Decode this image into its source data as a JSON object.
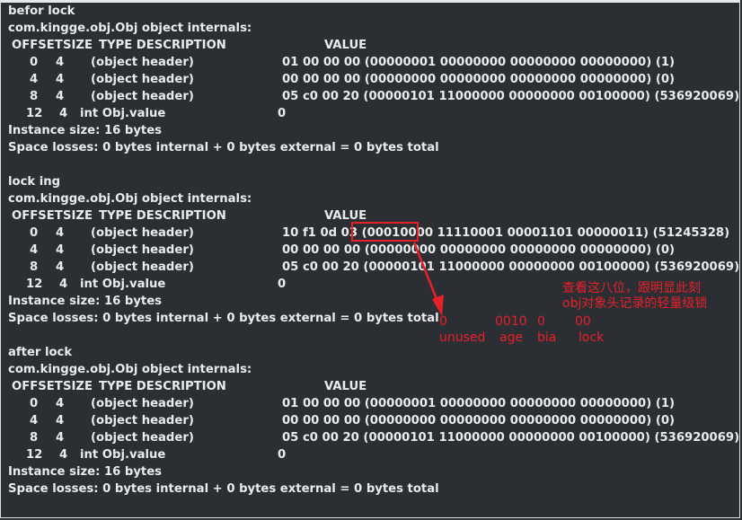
{
  "blocks": [
    {
      "title": "befor lock",
      "class_line": "com.kingge.obj.Obj object internals:",
      "header": {
        "offset": "OFFSET",
        "size": "SIZE",
        "type": "TYPE DESCRIPTION",
        "value": "VALUE"
      },
      "rows": [
        {
          "offset": "0",
          "size": "4",
          "type": "(object header)",
          "value": "01 00 00 00 (00000001 00000000 00000000 00000000) (1)"
        },
        {
          "offset": "4",
          "size": "4",
          "type": "(object header)",
          "value": "00 00 00 00 (00000000 00000000 00000000 00000000) (0)"
        },
        {
          "offset": "8",
          "size": "4",
          "type": "(object header)",
          "value": "05 c0 00 20 (00000101 11000000 00000000 00100000) (536920069)"
        },
        {
          "offset": "12",
          "size": "4",
          "type": "int Obj.value",
          "value": "0"
        }
      ],
      "instance": "Instance size: 16 bytes",
      "losses": "Space losses: 0 bytes internal + 0 bytes external = 0 bytes total"
    },
    {
      "title": "lock ing",
      "class_line": "com.kingge.obj.Obj object internals:",
      "header": {
        "offset": "OFFSET",
        "size": "SIZE",
        "type": "TYPE DESCRIPTION",
        "value": "VALUE"
      },
      "rows": [
        {
          "offset": "0",
          "size": "4",
          "type": "(object header)",
          "value": "10 f1 0d 03 (00010000 11110001 00001101 00000011) (51245328)"
        },
        {
          "offset": "4",
          "size": "4",
          "type": "(object header)",
          "value": "00 00 00 00 (00000000 00000000 00000000 00000000) (0)"
        },
        {
          "offset": "8",
          "size": "4",
          "type": "(object header)",
          "value": "05 c0 00 20 (00000101 11000000 00000000 00100000) (536920069)"
        },
        {
          "offset": "12",
          "size": "4",
          "type": "int Obj.value",
          "value": "0"
        }
      ],
      "instance": "Instance size: 16 bytes",
      "losses": "Space losses: 0 bytes internal + 0 bytes external = 0 bytes total"
    },
    {
      "title": "after lock",
      "class_line": "com.kingge.obj.Obj object internals:",
      "header": {
        "offset": "OFFSET",
        "size": "SIZE",
        "type": "TYPE DESCRIPTION",
        "value": "VALUE"
      },
      "rows": [
        {
          "offset": "0",
          "size": "4",
          "type": "(object header)",
          "value": "01 00 00 00 (00000001 00000000 00000000 00000000) (1)"
        },
        {
          "offset": "4",
          "size": "4",
          "type": "(object header)",
          "value": "00 00 00 00 (00000000 00000000 00000000 00000000) (0)"
        },
        {
          "offset": "8",
          "size": "4",
          "type": "(object header)",
          "value": "05 c0 00 20 (00000101 11000000 00000000 00100000) (536920069)"
        },
        {
          "offset": "12",
          "size": "4",
          "type": "int Obj.value",
          "value": "0"
        }
      ],
      "instance": "Instance size: 16 bytes",
      "losses": "Space losses: 0 bytes internal + 0 bytes external = 0 bytes total"
    }
  ],
  "annotation": {
    "note_line1": "查看这八位，跟明显此刻",
    "note_line2": "obj对象头记录的轻量级锁",
    "bits": [
      "0",
      "0010",
      "0",
      "00"
    ],
    "labels": [
      "unused",
      "age",
      "bia",
      "lock"
    ],
    "color": "#e8202a"
  }
}
